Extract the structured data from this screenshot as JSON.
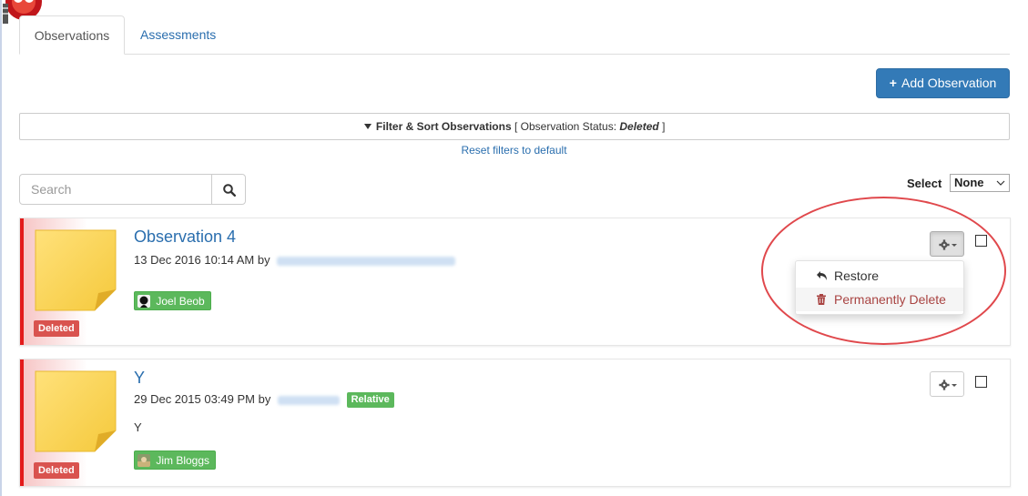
{
  "tabs": [
    {
      "label": "Observations",
      "active": true
    },
    {
      "label": "Assessments",
      "active": false
    }
  ],
  "toolbar": {
    "add_label": "Add Observation"
  },
  "filter": {
    "title": "Filter & Sort Observations",
    "status_prefix": "[ Observation Status:",
    "status_value": "Deleted",
    "status_suffix": "]",
    "reset_label": "Reset filters to default"
  },
  "search": {
    "placeholder": "Search"
  },
  "select": {
    "label": "Select",
    "value": "None"
  },
  "dropdown": {
    "restore_label": "Restore",
    "delete_label": "Permanently Delete"
  },
  "observations": [
    {
      "title": "Observation 4",
      "date": "13 Dec 2016 10:14 AM by",
      "status_badge": "Deleted",
      "child_name": "Joel Beob"
    },
    {
      "title": "Y",
      "date": "29 Dec 2015 03:49 PM by",
      "relation_badge": "Relative",
      "body": "Y",
      "status_badge": "Deleted",
      "child_name": "Jim Bloggs"
    }
  ],
  "colors": {
    "primary": "#337ab7",
    "link": "#2a6eae",
    "danger": "#d9534f",
    "success": "#5cb85c",
    "deleted_stripe": "#e31b1b",
    "highlight": "#e0484c"
  },
  "icons": [
    "logo-icon",
    "funnel-icon",
    "search-icon",
    "plus-icon",
    "gear-icon",
    "caret-down-icon",
    "undo-icon",
    "trash-icon",
    "sticky-note-icon",
    "avatar-icon"
  ]
}
